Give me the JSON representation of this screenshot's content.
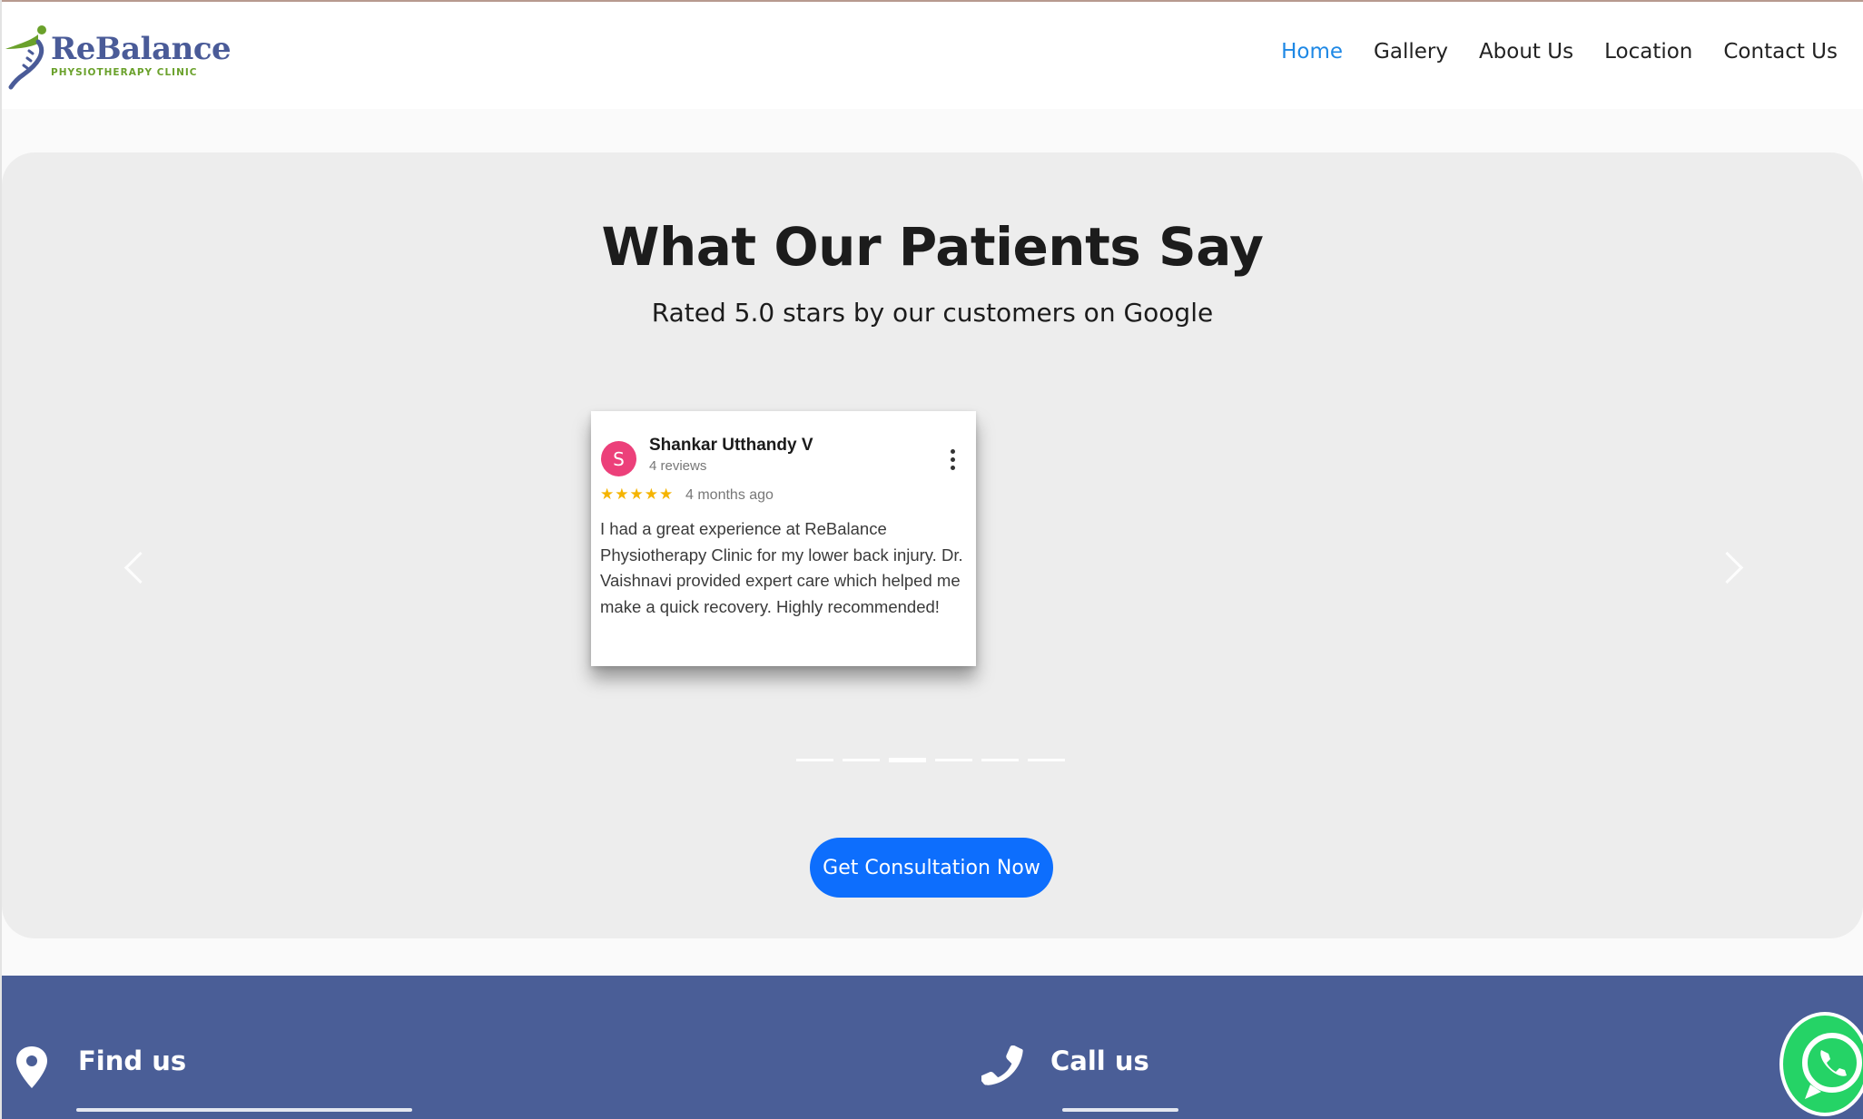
{
  "header": {
    "brand_name": "ReBalance",
    "brand_tagline": "PHYSIOTHERAPY CLINIC",
    "nav": [
      "Home",
      "Gallery",
      "About Us",
      "Location",
      "Contact Us"
    ],
    "active_nav": "Home"
  },
  "testimonials": {
    "title": "What Our Patients Say",
    "subtitle": "Rated 5.0 stars by our customers on Google",
    "review": {
      "avatar_letter": "S",
      "reviewer_name": "Shankar Utthandy V",
      "review_count": "4 reviews",
      "stars": "★★★★★",
      "rating": 5,
      "time_ago": "4 months ago",
      "text": "I had a great experience at ReBalance Physiotherapy Clinic for my lower back injury. Dr. Vaishnavi provided expert care which helped me make a quick recovery. Highly recommended!"
    },
    "slides_total": 6,
    "active_slide_index": 2,
    "cta_label": "Get Consultation Now"
  },
  "footer": {
    "find_us_heading": "Find us",
    "call_us_heading": "Call us"
  },
  "colors": {
    "brand": "#4a5b98",
    "accent_green": "#6aa12b",
    "nav_active": "#1e88e5",
    "cta": "#0d6efd",
    "footer_bg": "#4a5e97",
    "whatsapp": "#25d366",
    "avatar": "#ec407a",
    "stars": "#f5b400"
  },
  "icons": {
    "logo": "spine-figure-logo-icon",
    "prev": "chevron-left-icon",
    "next": "chevron-right-icon",
    "menu": "more-vertical-icon",
    "find_us": "map-pin-icon",
    "call_us": "phone-icon",
    "chat": "whatsapp-icon"
  }
}
